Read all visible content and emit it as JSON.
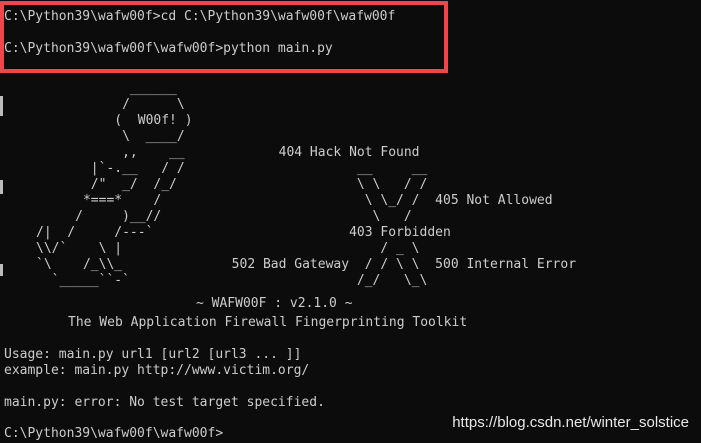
{
  "terminal": {
    "background": "#0c0c0c",
    "foreground": "#cccccc",
    "highlight_color": "#f0454a",
    "cmd1": "C:\\Python39\\wafw00f>cd C:\\Python39\\wafw00f\\wafw00f",
    "cmd2": "C:\\Python39\\wafw00f\\wafw00f>python main.py",
    "logo_art": "            ______\n           /      \\\n          (  W00f! )\n           \\  ____/\n           ,,    __            404 Hack Not Found\n       |`-.__   / /                      __     __\n       /\"  _/  /_/                       \\ \\   / /\n      *===*    /                          \\ \\_/ /  405 Not Allowed\n     /     )__//                           \\   /\n/|  /     /---`                         403 Forbidden\n\\\\/`    \\ |                                 / _ \\\n`\\    /_\\\\_              502 Bad Gateway  / / \\ \\  500 Internal Error\n  `_____``-`                             /_/   \\_\\",
    "version_line": "~ WAFW00F : v2.1.0 ~",
    "toolkit_line": "The Web Application Firewall Fingerprinting Toolkit",
    "usage_line": "Usage: main.py url1 [url2 [url3 ... ]]",
    "example_line": "example: main.py http://www.victim.org/",
    "error_line": "main.py: error: No test target specified.",
    "prompt_line": "C:\\Python39\\wafw00f\\wafw00f>"
  },
  "watermark": {
    "text": "https://blog.csdn.net/winter_solstice"
  }
}
